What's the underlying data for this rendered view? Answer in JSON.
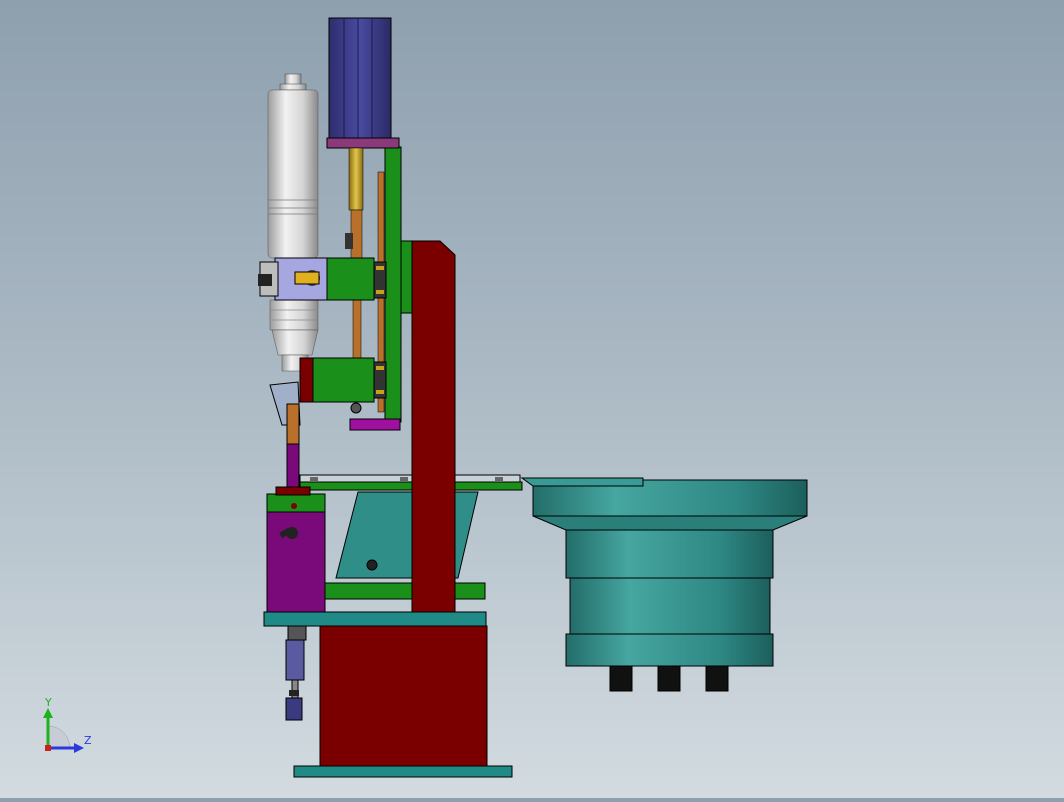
{
  "colors": {
    "background_top": "#8e9fae",
    "background_bottom": "#d3dbe0",
    "frame_red": "#7a0000",
    "teal": "#1f8a86",
    "bowl_teal": "#2e8b86",
    "green": "#1a8f1a",
    "purple": "#7a0a7a",
    "motor_navy": "#3a3a86",
    "silver": "#d0d0d0",
    "bronze": "#b8702a",
    "axis_y": "#1db31d",
    "axis_z": "#2a3adb"
  },
  "axis_triad": {
    "y_label": "Y",
    "z_label": "Z"
  },
  "parts": {
    "servo_motor": "servo-motor",
    "ultrasonic_transducer": "ultrasonic-transducer",
    "vibratory_bowl": "vibratory-bowl-feeder"
  }
}
